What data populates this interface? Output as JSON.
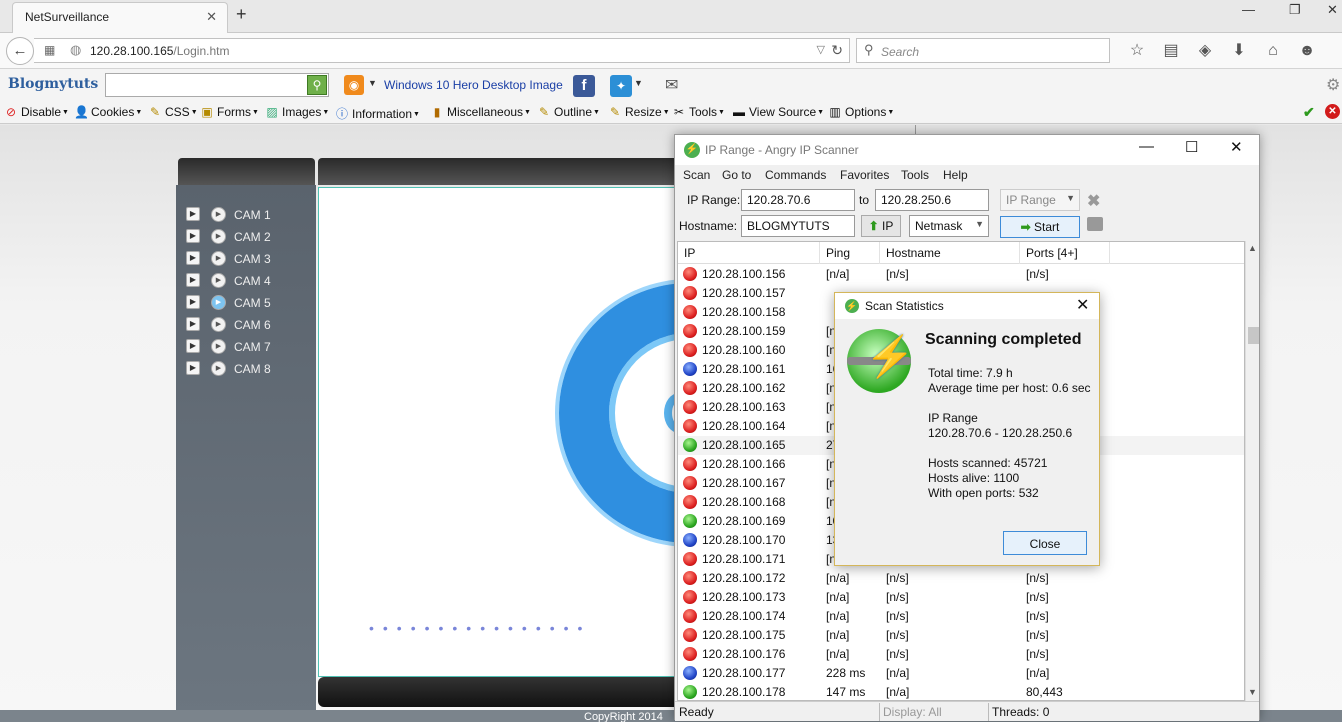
{
  "browser": {
    "tab_title": "NetSurveillance",
    "url_host": "120.28.100.165",
    "url_path": "/Login.htm",
    "search_placeholder": "Search"
  },
  "bookmarks": {
    "brand": "Blogmytuts",
    "link": "Windows 10 Hero Desktop Image"
  },
  "devtools": [
    "Disable",
    "Cookies",
    "CSS",
    "Forms",
    "Images",
    "Information",
    "Miscellaneous",
    "Outline",
    "Resize",
    "Tools",
    "View Source",
    "Options"
  ],
  "page": {
    "cams": [
      "CAM 1",
      "CAM 2",
      "CAM 3",
      "CAM 4",
      "CAM 5",
      "CAM 6",
      "CAM 7",
      "CAM 8"
    ],
    "active_cam": "CAM 5",
    "copyright": "CopyRight 2014"
  },
  "scanner": {
    "title": "IP Range - Angry IP Scanner",
    "menu": [
      "Scan",
      "Go to",
      "Commands",
      "Favorites",
      "Tools",
      "Help"
    ],
    "ip_range_label": "IP Range:",
    "ip_from": "120.28.70.6",
    "to_label": "to",
    "ip_to": "120.28.250.6",
    "mode": "IP Range",
    "hostname_label": "Hostname:",
    "hostname": "BLOGMYTUTS",
    "ip_button": "IP",
    "netmask": "Netmask",
    "start_button": "Start",
    "columns": [
      "IP",
      "Ping",
      "Hostname",
      "Ports [4+]"
    ],
    "rows": [
      {
        "status": "red",
        "ip": "120.28.100.156",
        "ping": "[n/a]",
        "host": "[n/s]",
        "ports": "[n/s]"
      },
      {
        "status": "red",
        "ip": "120.28.100.157",
        "ping": "",
        "host": "",
        "ports": ""
      },
      {
        "status": "red",
        "ip": "120.28.100.158",
        "ping": "",
        "host": "",
        "ports": ""
      },
      {
        "status": "red",
        "ip": "120.28.100.159",
        "ping": "[n,",
        "host": "",
        "ports": ""
      },
      {
        "status": "red",
        "ip": "120.28.100.160",
        "ping": "[n,",
        "host": "",
        "ports": ""
      },
      {
        "status": "blue",
        "ip": "120.28.100.161",
        "ping": "16",
        "host": "",
        "ports": ""
      },
      {
        "status": "red",
        "ip": "120.28.100.162",
        "ping": "[n,",
        "host": "",
        "ports": ""
      },
      {
        "status": "red",
        "ip": "120.28.100.163",
        "ping": "[n,",
        "host": "",
        "ports": ""
      },
      {
        "status": "red",
        "ip": "120.28.100.164",
        "ping": "[n,",
        "host": "",
        "ports": ""
      },
      {
        "status": "green",
        "ip": "120.28.100.165",
        "ping": "27",
        "host": "",
        "ports": ""
      },
      {
        "status": "red",
        "ip": "120.28.100.166",
        "ping": "[n,",
        "host": "",
        "ports": ""
      },
      {
        "status": "red",
        "ip": "120.28.100.167",
        "ping": "[n,",
        "host": "",
        "ports": ""
      },
      {
        "status": "red",
        "ip": "120.28.100.168",
        "ping": "[n,",
        "host": "",
        "ports": ""
      },
      {
        "status": "green",
        "ip": "120.28.100.169",
        "ping": "10",
        "host": "",
        "ports": ""
      },
      {
        "status": "blue",
        "ip": "120.28.100.170",
        "ping": "13",
        "host": "",
        "ports": ""
      },
      {
        "status": "red",
        "ip": "120.28.100.171",
        "ping": "[n,",
        "host": "",
        "ports": ""
      },
      {
        "status": "red",
        "ip": "120.28.100.172",
        "ping": "[n/a]",
        "host": "[n/s]",
        "ports": "[n/s]"
      },
      {
        "status": "red",
        "ip": "120.28.100.173",
        "ping": "[n/a]",
        "host": "[n/s]",
        "ports": "[n/s]"
      },
      {
        "status": "red",
        "ip": "120.28.100.174",
        "ping": "[n/a]",
        "host": "[n/s]",
        "ports": "[n/s]"
      },
      {
        "status": "red",
        "ip": "120.28.100.175",
        "ping": "[n/a]",
        "host": "[n/s]",
        "ports": "[n/s]"
      },
      {
        "status": "red",
        "ip": "120.28.100.176",
        "ping": "[n/a]",
        "host": "[n/s]",
        "ports": "[n/s]"
      },
      {
        "status": "blue",
        "ip": "120.28.100.177",
        "ping": "228 ms",
        "host": "[n/a]",
        "ports": "[n/a]"
      },
      {
        "status": "green",
        "ip": "120.28.100.178",
        "ping": "147 ms",
        "host": "[n/a]",
        "ports": "80,443"
      }
    ],
    "status_ready": "Ready",
    "status_display": "Display: All",
    "status_threads": "Threads: 0"
  },
  "dialog": {
    "title": "Scan Statistics",
    "heading": "Scanning completed",
    "total_time": "Total time: 7.9 h",
    "avg_time": "Average time per host: 0.6 sec",
    "range_label": "IP Range",
    "range_value": "120.28.70.6 - 120.28.250.6",
    "hosts_scanned": "Hosts scanned: 45721",
    "hosts_alive": "Hosts alive: 1100",
    "open_ports": "With open ports: 532",
    "close_button": "Close"
  }
}
